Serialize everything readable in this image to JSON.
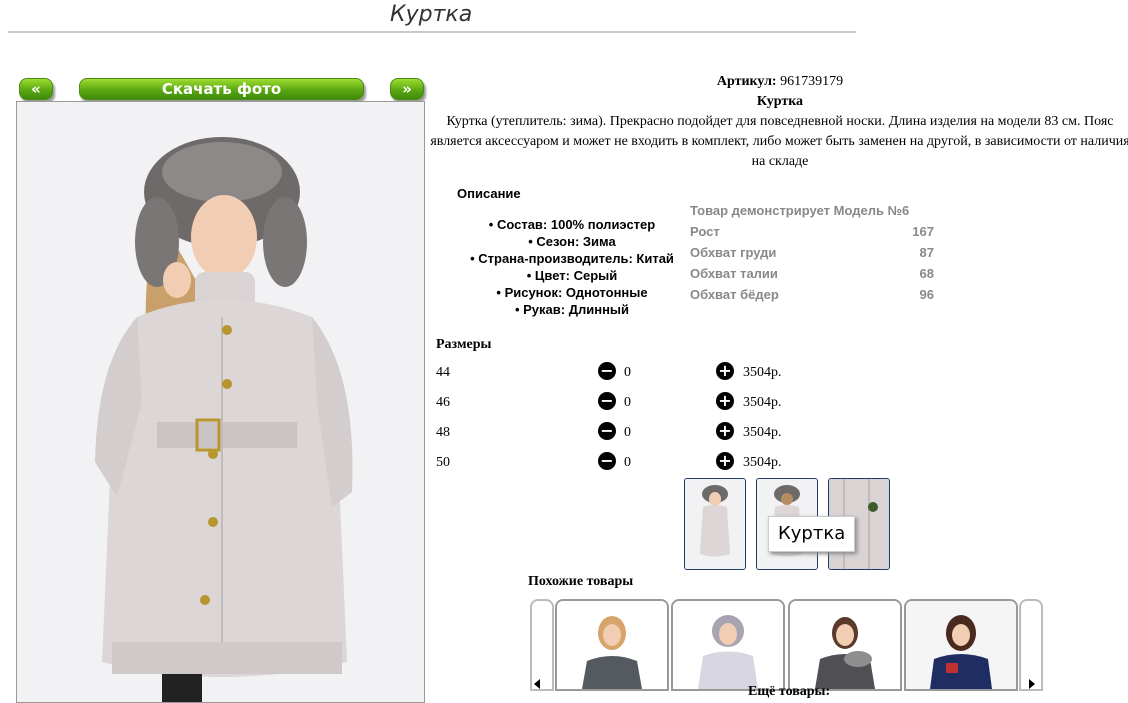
{
  "page": {
    "title": "Куртка"
  },
  "gallery": {
    "prev_label": "«",
    "download_label": "Скачать фото",
    "next_label": "»"
  },
  "product": {
    "article_label": "Артикул:",
    "article_value": "961739179",
    "name": "Куртка",
    "description": "Куртка (утеплитель: зима). Прекрасно подойдет для повседневной носки. Длина изделия на модели 83 см. Пояс является аксессуаром и может не входить в комплект, либо может быть заменен на другой, в зависимости от наличия на складе"
  },
  "details": {
    "heading": "Описание",
    "attributes": [
      "Состав: 100% полиэстер",
      "Сезон: Зима",
      "Страна-производитель: Китай",
      "Цвет: Серый",
      "Рисунок: Однотонные",
      "Рукав: Длинный"
    ]
  },
  "model": {
    "heading": "Товар демонстрирует Модель №6",
    "rows": [
      {
        "label": "Рост",
        "value": "167"
      },
      {
        "label": "Обхват груди",
        "value": "87"
      },
      {
        "label": "Обхват талии",
        "value": "68"
      },
      {
        "label": "Обхват бёдер",
        "value": "96"
      }
    ]
  },
  "sizes": {
    "heading": "Размеры",
    "rows": [
      {
        "size": "44",
        "qty": "0",
        "price": "3504р."
      },
      {
        "size": "46",
        "qty": "0",
        "price": "3504р."
      },
      {
        "size": "48",
        "qty": "0",
        "price": "3504р."
      },
      {
        "size": "50",
        "qty": "0",
        "price": "3504р."
      }
    ]
  },
  "tooltip": {
    "text": "Куртка"
  },
  "similar": {
    "heading": "Похожие товары"
  },
  "more": {
    "heading": "Ещё товары:"
  },
  "colors": {
    "button_green": "#5aa812",
    "thumb_border": "#1c3c6c",
    "model_text": "#888888"
  }
}
